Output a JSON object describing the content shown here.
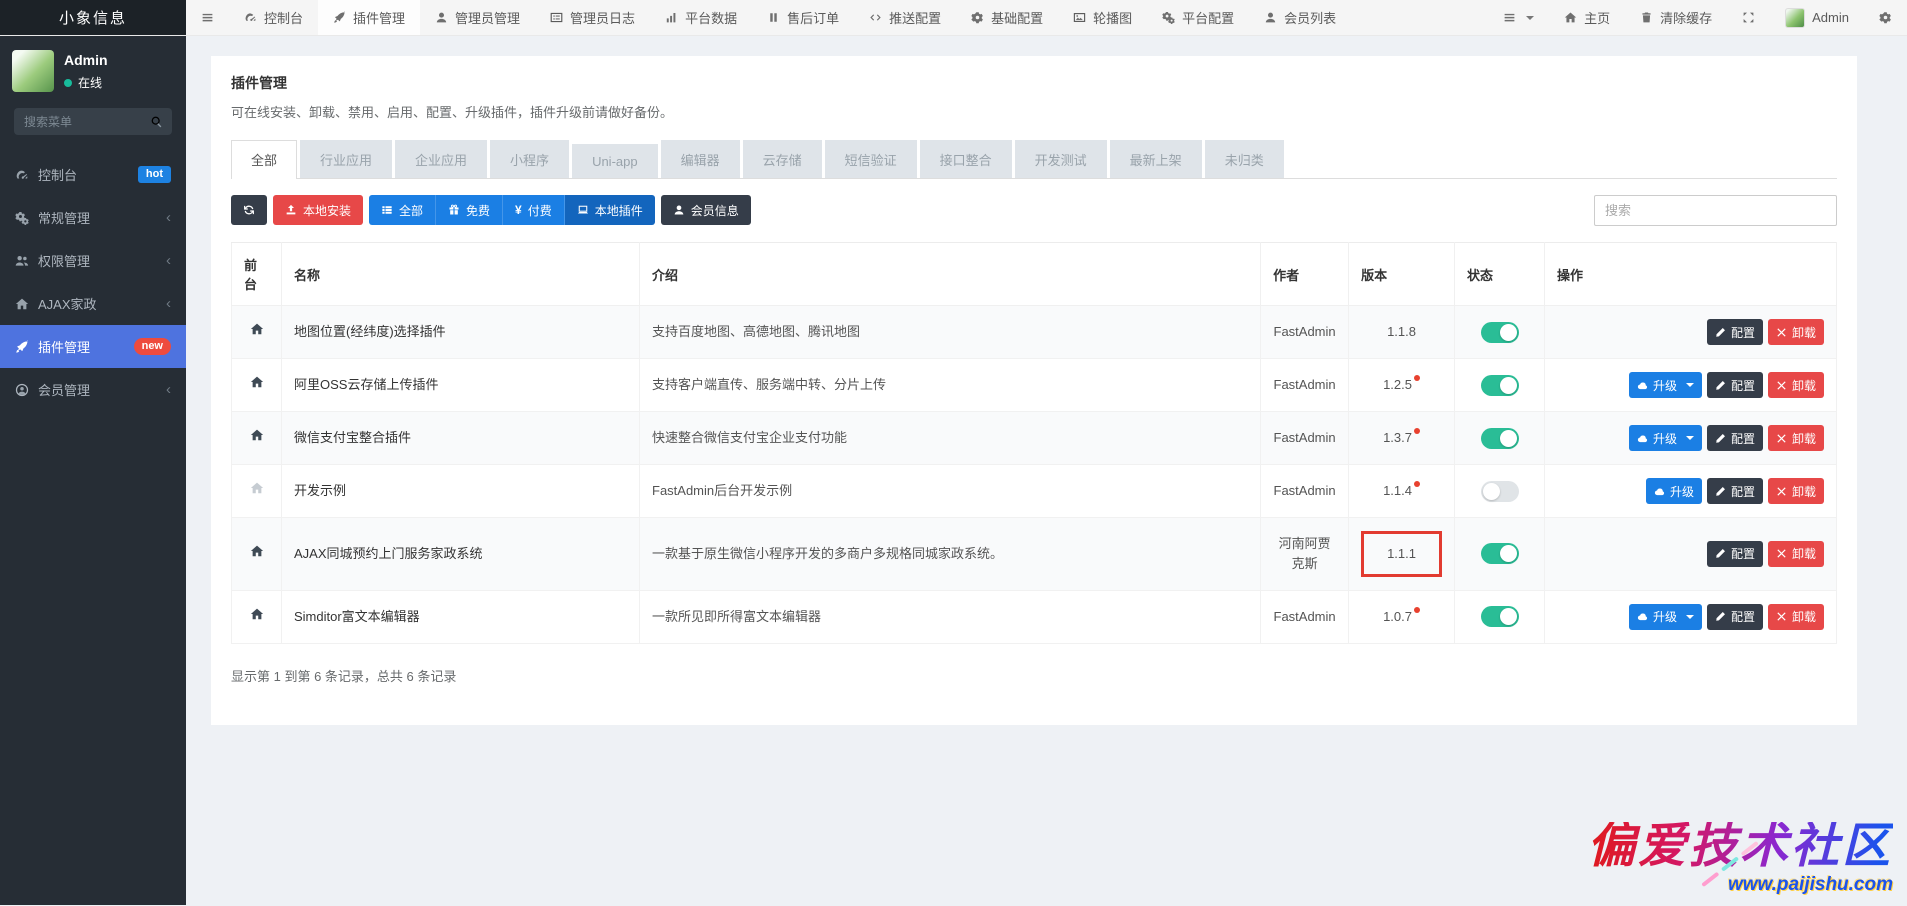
{
  "brand": {
    "title": "小象信息"
  },
  "topnav": {
    "items": [
      {
        "icon": "gauge",
        "label": "控制台",
        "name": "dashboard"
      },
      {
        "icon": "rocket",
        "label": "插件管理",
        "name": "addon",
        "active": true
      },
      {
        "icon": "user",
        "label": "管理员管理",
        "name": "admin"
      },
      {
        "icon": "list",
        "label": "管理员日志",
        "name": "admin-log"
      },
      {
        "icon": "chart",
        "label": "平台数据",
        "name": "platform-data"
      },
      {
        "icon": "pause",
        "label": "售后订单",
        "name": "aftersale-order"
      },
      {
        "icon": "code",
        "label": "推送配置",
        "name": "push-config"
      },
      {
        "icon": "gear",
        "label": "基础配置",
        "name": "base-config"
      },
      {
        "icon": "image",
        "label": "轮播图",
        "name": "banner"
      },
      {
        "icon": "gears",
        "label": "平台配置",
        "name": "platform-config"
      },
      {
        "icon": "user",
        "label": "会员列表",
        "name": "member-list"
      }
    ],
    "right": [
      {
        "icon": "bars",
        "label": "",
        "caret": true,
        "name": "nav-list-dropdown"
      },
      {
        "icon": "home",
        "label": "主页",
        "name": "home-link"
      },
      {
        "icon": "trash",
        "label": "清除缓存",
        "name": "clear-cache"
      },
      {
        "icon": "expand",
        "label": "",
        "name": "fullscreen-toggle"
      },
      {
        "avatar": true,
        "label": "Admin",
        "name": "user-menu"
      },
      {
        "icon": "gear",
        "label": "",
        "name": "settings-menu"
      }
    ]
  },
  "sidebar": {
    "user": {
      "name": "Admin",
      "status": "在线"
    },
    "search_placeholder": "搜索菜单",
    "items": [
      {
        "icon": "gauge",
        "label": "控制台",
        "name": "dashboard",
        "badge": "hot",
        "badge_color": "#1d82e2",
        "badge_pill": false
      },
      {
        "icon": "gears",
        "label": "常规管理",
        "name": "general",
        "chevron": true
      },
      {
        "icon": "users",
        "label": "权限管理",
        "name": "auth",
        "chevron": true
      },
      {
        "icon": "home",
        "label": "AJAX家政",
        "name": "ajax-housekeeping",
        "chevron": true
      },
      {
        "icon": "rocket",
        "label": "插件管理",
        "name": "addon",
        "active": true,
        "badge": "new",
        "badge_color": "#ee4b3e",
        "badge_pill": true
      },
      {
        "icon": "user-circle",
        "label": "会员管理",
        "name": "member",
        "chevron": true
      }
    ]
  },
  "page": {
    "title": "插件管理",
    "subtitle": "可在线安装、卸载、禁用、启用、配置、升级插件，插件升级前请做好备份。"
  },
  "tabs": [
    {
      "label": "全部",
      "active": true
    },
    {
      "label": "行业应用"
    },
    {
      "label": "企业应用"
    },
    {
      "label": "小程序"
    },
    {
      "label": "Uni-app"
    },
    {
      "label": "编辑器"
    },
    {
      "label": "云存储"
    },
    {
      "label": "短信验证"
    },
    {
      "label": "接口整合"
    },
    {
      "label": "开发测试"
    },
    {
      "label": "最新上架"
    },
    {
      "label": "未归类"
    }
  ],
  "toolbar": {
    "buttons": [
      {
        "type": "button",
        "style": "dark",
        "icon": "refresh",
        "label": "",
        "name": "refresh-button"
      },
      {
        "type": "button",
        "style": "danger",
        "icon": "upload",
        "label": "本地安装",
        "name": "local-install-button"
      },
      {
        "type": "group",
        "name": "addon-filter-group",
        "items": [
          {
            "icon": "thlist",
            "label": "全部",
            "name": "filter-all-button"
          },
          {
            "icon": "gift",
            "label": "免费",
            "name": "filter-free-button"
          },
          {
            "icon": "yen",
            "label": "付费",
            "name": "filter-paid-button"
          },
          {
            "icon": "laptop",
            "label": "本地插件",
            "name": "filter-local-button",
            "active": true
          }
        ]
      },
      {
        "type": "button",
        "style": "dark",
        "icon": "user",
        "label": "会员信息",
        "name": "member-info-button"
      }
    ],
    "search_placeholder": "搜索"
  },
  "table": {
    "columns": [
      "前台",
      "名称",
      "介绍",
      "作者",
      "版本",
      "状态",
      "操作"
    ],
    "action_labels": {
      "upgrade": "升级",
      "config": "配置",
      "uninstall": "卸载"
    },
    "rows": [
      {
        "name": "地图位置(经纬度)选择插件",
        "intro": "支持百度地图、高德地图、腾讯地图",
        "author": "FastAdmin",
        "version": "1.1.8",
        "update_dot": false,
        "enabled": true,
        "status_on": true,
        "highlight": false,
        "actions": [
          "config",
          "uninstall"
        ]
      },
      {
        "name": "阿里OSS云存储上传插件",
        "intro": "支持客户端直传、服务端中转、分片上传",
        "author": "FastAdmin",
        "version": "1.2.5",
        "update_dot": true,
        "enabled": true,
        "status_on": true,
        "highlight": false,
        "actions": [
          "upgrade-caret",
          "config",
          "uninstall"
        ]
      },
      {
        "name": "微信支付宝整合插件",
        "intro": "快速整合微信支付宝企业支付功能",
        "author": "FastAdmin",
        "version": "1.3.7",
        "update_dot": true,
        "enabled": true,
        "status_on": true,
        "highlight": false,
        "actions": [
          "upgrade-caret",
          "config",
          "uninstall"
        ]
      },
      {
        "name": "开发示例",
        "intro": "FastAdmin后台开发示例",
        "author": "FastAdmin",
        "version": "1.1.4",
        "update_dot": true,
        "enabled": false,
        "status_on": false,
        "highlight": false,
        "actions": [
          "upgrade",
          "config",
          "uninstall"
        ]
      },
      {
        "name": "AJAX同城预约上门服务家政系统",
        "intro": "一款基于原生微信小程序开发的多商户多规格同城家政系统。",
        "author": "河南阿贾克斯",
        "version": "1.1.1",
        "update_dot": false,
        "enabled": true,
        "status_on": true,
        "highlight": true,
        "actions": [
          "config",
          "uninstall"
        ]
      },
      {
        "name": "Simditor富文本编辑器",
        "intro": "一款所见即所得富文本编辑器",
        "author": "FastAdmin",
        "version": "1.0.7",
        "update_dot": true,
        "enabled": true,
        "status_on": true,
        "highlight": false,
        "actions": [
          "upgrade-caret",
          "config",
          "uninstall"
        ]
      }
    ]
  },
  "footer": {
    "summary": "显示第 1 到第 6 条记录，总共 6 条记录"
  },
  "watermark": {
    "text": "偏爱技术社区",
    "url": "www.paijishu.com"
  },
  "colors": {
    "accent_blue": "#1b7fe4",
    "accent_blue_active": "#1365bd",
    "danger_red": "#e74848",
    "dark_button": "#353d49",
    "toggle_on": "#2abd96",
    "sidebar_active": "#4e73df",
    "badge_hot": "#1d82e2",
    "badge_new": "#ee4b3e",
    "highlight_box": "#e23b30"
  }
}
